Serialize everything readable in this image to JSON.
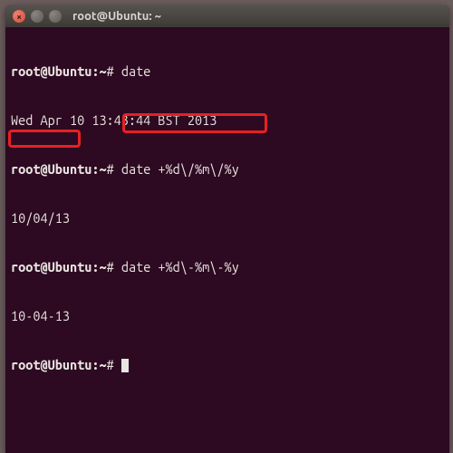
{
  "window": {
    "title": "root@Ubuntu: ~"
  },
  "prompt": {
    "userhost": "root@Ubuntu",
    "sep": ":",
    "path": "~",
    "symbol": "#"
  },
  "lines": [
    {
      "type": "cmd",
      "text": "date"
    },
    {
      "type": "out",
      "text": "Wed Apr 10 13:43:44 BST 2013"
    },
    {
      "type": "cmd",
      "text": "date +%d\\/%m\\/%y"
    },
    {
      "type": "out",
      "text": "10/04/13"
    },
    {
      "type": "cmd",
      "text": "date +%d\\-%m\\-%y"
    },
    {
      "type": "out",
      "text": "10-04-13"
    },
    {
      "type": "cmd",
      "text": ""
    }
  ]
}
